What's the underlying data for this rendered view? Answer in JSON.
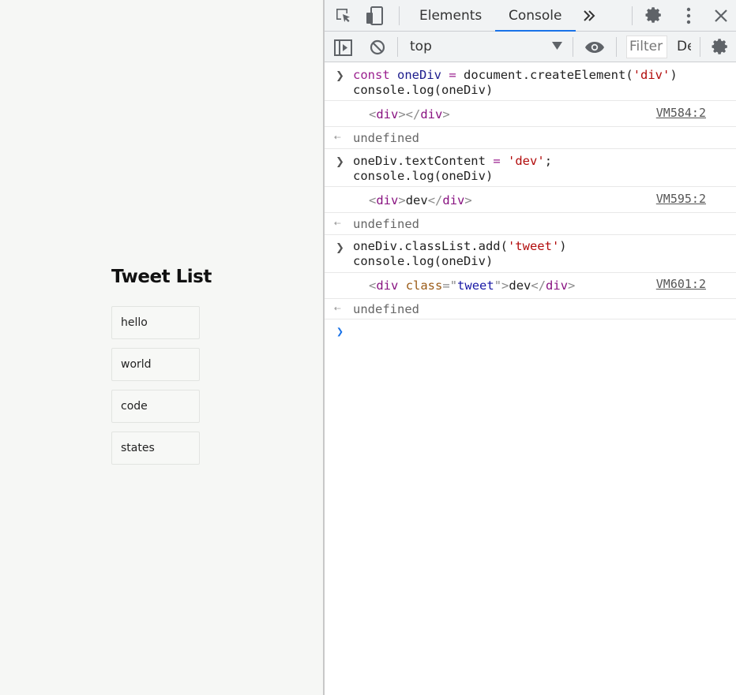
{
  "page": {
    "title": "Tweet List",
    "tweets": [
      "hello",
      "world",
      "code",
      "states"
    ]
  },
  "devtools": {
    "tabs": {
      "elements": "Elements",
      "console": "Console"
    },
    "context": "top",
    "filter_placeholder": "Filter",
    "levels_label": "De",
    "icons": {
      "inspect": "inspect-element-icon",
      "device": "device-toolbar-icon",
      "more_tabs": "chevron-double-right-icon",
      "settings": "gear-icon",
      "menu": "kebab-menu-icon",
      "close": "close-icon",
      "sidebar": "sidebar-toggle-icon",
      "clear": "clear-console-icon",
      "eye": "eye-icon",
      "console_settings": "gear-icon"
    },
    "console": {
      "entries": [
        {
          "type": "input",
          "line1": {
            "kw": "const",
            "var": "oneDiv",
            "op": "=",
            "rest_a": "document.createElement(",
            "str": "'div'",
            "rest_b": ")"
          },
          "line2": "console.log(oneDiv)"
        },
        {
          "type": "log",
          "open": "div",
          "close": "div",
          "content": "",
          "source": "VM584:2"
        },
        {
          "type": "result",
          "text": "undefined"
        },
        {
          "type": "input",
          "line1": {
            "a": "oneDiv.textContent",
            "op": "=",
            "str": "'dev'",
            "b": ";"
          },
          "line2": "console.log(oneDiv)"
        },
        {
          "type": "log",
          "open": "div",
          "close": "div",
          "content": "dev",
          "source": "VM595:2"
        },
        {
          "type": "result",
          "text": "undefined"
        },
        {
          "type": "input",
          "line1": {
            "a": "oneDiv.classList.add(",
            "str": "'tweet'",
            "b": ")"
          },
          "line2": "console.log(oneDiv)"
        },
        {
          "type": "log",
          "open": "div",
          "attr": "class",
          "attr_val": "tweet",
          "close": "div",
          "content": "dev",
          "source": "VM601:2"
        },
        {
          "type": "result",
          "text": "undefined"
        }
      ]
    }
  }
}
